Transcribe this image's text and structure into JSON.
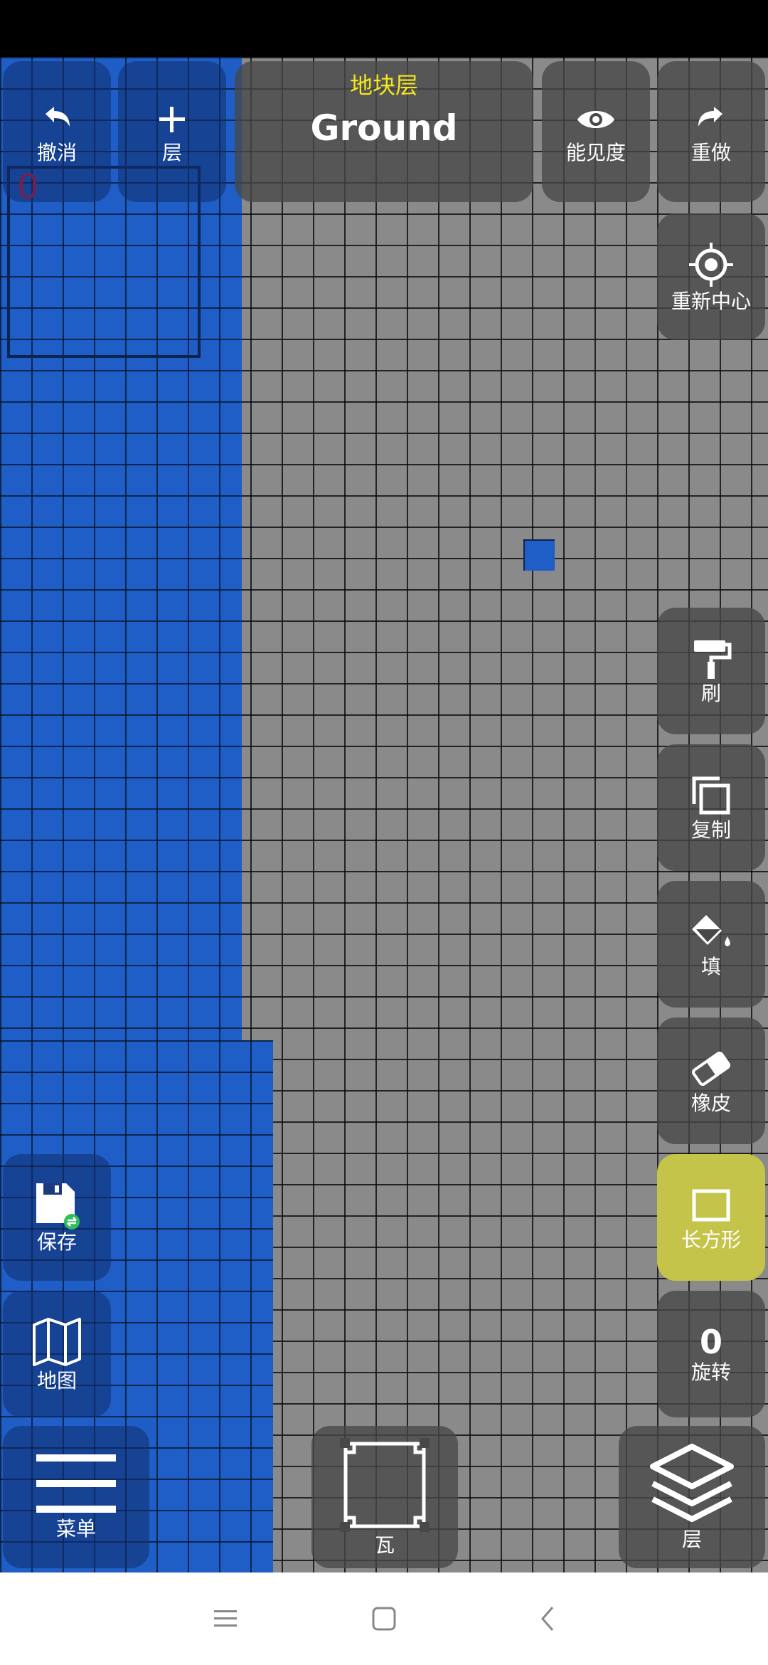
{
  "toolbar": {
    "undo_label": "撤消",
    "layer_add_label": "层",
    "layer_caption": "地块层",
    "layer_name": "Ground",
    "visibility_label": "能见度",
    "redo_label": "重做",
    "recenter_label": "重新中心"
  },
  "selection": {
    "count": "0"
  },
  "tools": {
    "brush_label": "刷",
    "copy_label": "复制",
    "fill_label": "填",
    "eraser_label": "橡皮",
    "rect_label": "长方形",
    "rotate_value": "0",
    "rotate_label": "旋转",
    "active_tool": "rectangle",
    "active_color": "#c4c44b"
  },
  "left_tools": {
    "save_label": "保存",
    "map_label": "地图"
  },
  "bottom": {
    "menu_label": "菜单",
    "tile_label": "瓦",
    "layers_label": "层"
  },
  "colors": {
    "water": "#1e5ec6",
    "ground": "#8a8a8a",
    "layer_caption": "#f5e61e",
    "selection_count": "#e0162a"
  },
  "icons": {
    "undo": "undo-icon",
    "add": "plus-icon",
    "visibility": "eye-icon",
    "redo": "redo-icon",
    "recenter": "crosshair-icon",
    "brush": "paint-roller-icon",
    "copy": "copy-icon",
    "fill": "paint-bucket-icon",
    "eraser": "eraser-icon",
    "rect": "rectangle-icon",
    "save": "floppy-sync-icon",
    "map": "map-icon",
    "menu": "hamburger-icon",
    "tile": "tile-outline-icon",
    "layers": "layers-icon"
  }
}
